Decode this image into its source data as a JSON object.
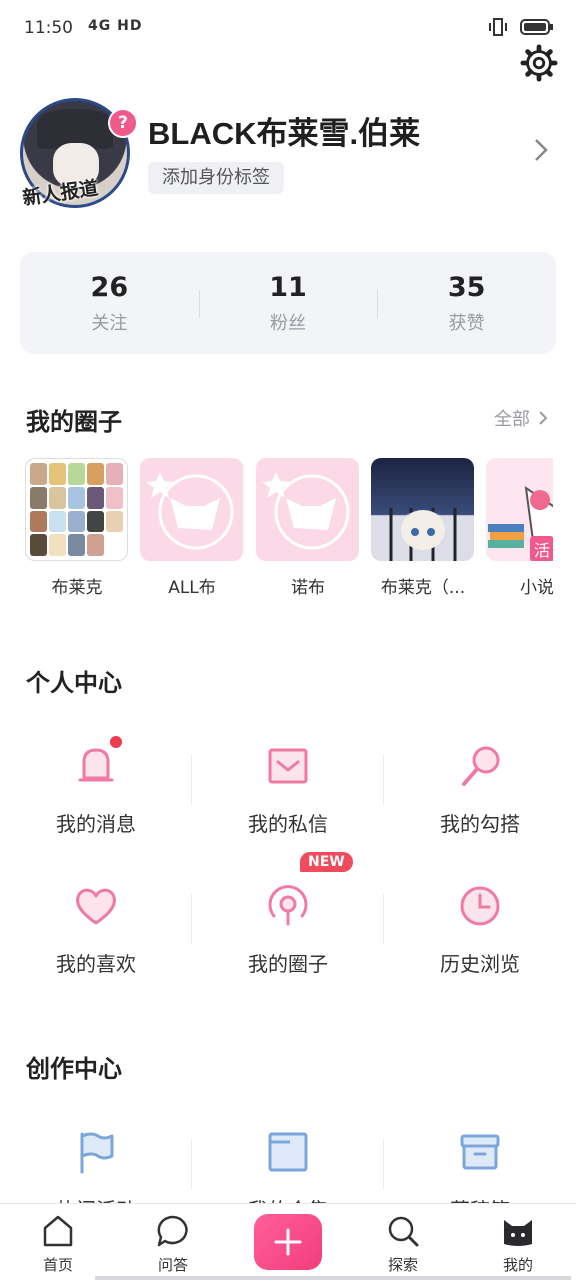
{
  "status": {
    "time": "11:50",
    "network": "4G HD"
  },
  "profile": {
    "username": "BLACK布莱雪.伯莱",
    "tag_button": "添加身份标签",
    "avatar_badge": "?",
    "avatar_banner": "新人报道"
  },
  "stats": [
    {
      "num": "26",
      "label": "关注"
    },
    {
      "num": "11",
      "label": "粉丝"
    },
    {
      "num": "35",
      "label": "获赞"
    }
  ],
  "circles_section": {
    "title": "我的圈子",
    "more": "全部"
  },
  "circles": [
    {
      "name": "布莱克"
    },
    {
      "name": "ALL布"
    },
    {
      "name": "诺布"
    },
    {
      "name": "布莱克（..."
    },
    {
      "name": "小说",
      "badge": "活"
    }
  ],
  "personal_center": {
    "title": "个人中心",
    "items": [
      {
        "label": "我的消息"
      },
      {
        "label": "我的私信"
      },
      {
        "label": "我的勾搭"
      },
      {
        "label": "我的喜欢"
      },
      {
        "label": "我的圈子",
        "badge": "NEW"
      },
      {
        "label": "历史浏览"
      }
    ]
  },
  "creation_center": {
    "title": "创作中心",
    "items": [
      {
        "label": "热门活动"
      },
      {
        "label": "我的合集"
      },
      {
        "label": "草稿箱"
      }
    ]
  },
  "nav": {
    "home": "首页",
    "qa": "问答",
    "explore": "探索",
    "mine": "我的"
  },
  "colors": {
    "accent": "#f23d7c",
    "icon_pink": "#f07aa0",
    "icon_blue": "#7ba6d8"
  }
}
